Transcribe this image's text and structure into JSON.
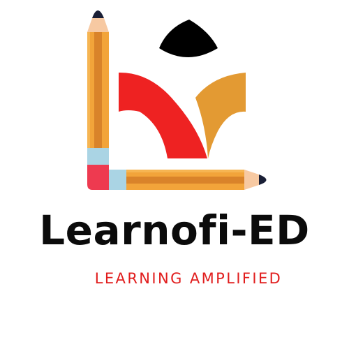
{
  "brand": {
    "name": "Learnofi-ED",
    "tagline": "LEARNING AMPLIFIED"
  },
  "colors": {
    "background": "#ffffff",
    "pencil_body": "#f2a43a",
    "pencil_stripe": "#d9832a",
    "pencil_wood": "#f7c9a2",
    "pencil_lead": "#1a1f36",
    "ferrule": "#aad4e4",
    "eraser": "#ee3a50",
    "book_left": "#ee2222",
    "book_right": "#e39a33",
    "head": "#000000",
    "brand_text": "#0b0b0b",
    "tagline_text": "#e11d1d"
  },
  "icons": {
    "vertical_pencil": "pencil-icon",
    "horizontal_pencil": "pencil-icon",
    "open_book": "open-book-icon",
    "reader_head": "head-icon"
  }
}
